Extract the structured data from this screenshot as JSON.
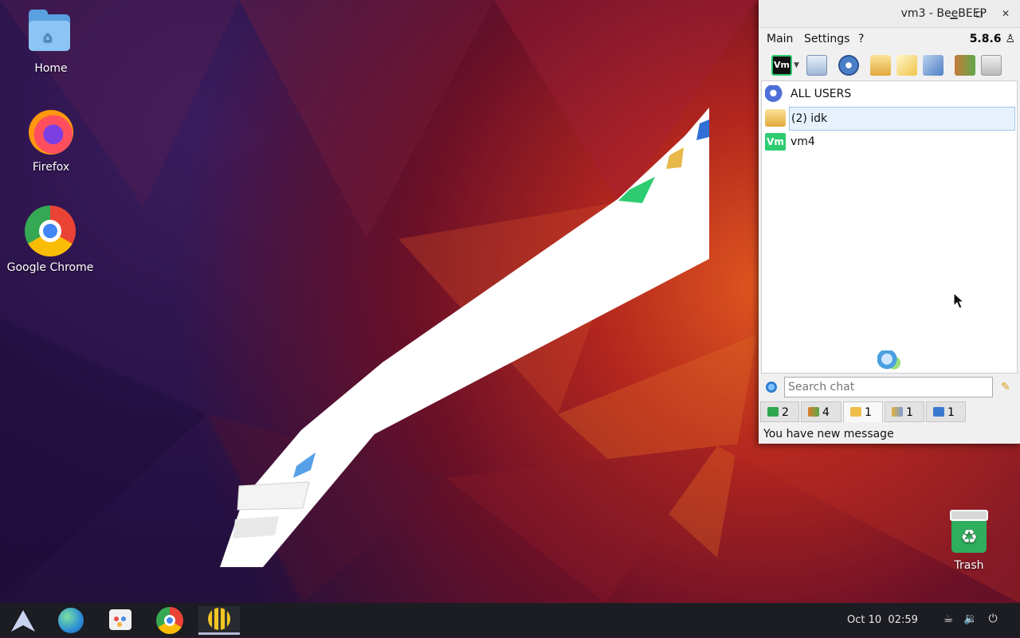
{
  "desktop": {
    "icons": [
      {
        "label": "Home",
        "icon": "home-folder-icon"
      },
      {
        "label": "Firefox",
        "icon": "firefox-icon"
      },
      {
        "label": "Google Chrome",
        "icon": "chrome-icon"
      },
      {
        "label": "Trash",
        "icon": "trash-icon"
      }
    ]
  },
  "window": {
    "title": "vm3 - BeeBEEP",
    "menu": [
      "Main",
      "Settings",
      "?"
    ],
    "version": "5.8.6",
    "users": [
      {
        "label": "ALL USERS",
        "icon": "chat-bubbles-icon"
      },
      {
        "label": "(2) idk",
        "icon": "new-message-envelope-icon",
        "selected": true
      },
      {
        "label": "vm4",
        "icon": "vm-icon"
      }
    ],
    "search_placeholder": "Search chat",
    "tabs": [
      {
        "count": "2",
        "icon": "computer-icon"
      },
      {
        "count": "4",
        "icon": "users-icon"
      },
      {
        "count": "1",
        "icon": "envelope-icon",
        "active": true
      },
      {
        "count": "1",
        "icon": "group-icon"
      },
      {
        "count": "1",
        "icon": "pen-icon"
      }
    ],
    "status": "You have new message"
  },
  "taskbar": {
    "date": "Oct 10",
    "time": "02:59"
  }
}
